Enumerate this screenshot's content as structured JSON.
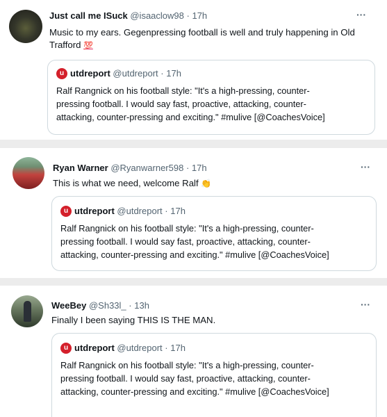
{
  "tweets": [
    {
      "name": "Just call me ISuck",
      "handle": "@isaaclow98",
      "time": "17h",
      "text": "Music to my ears. Gegenpressing football is well and truly happening in Old",
      "text2": "Trafford",
      "emoji": "💯",
      "more": "···",
      "quote": {
        "name": "utdreport",
        "handle": "@utdreport",
        "time": "17h",
        "lines": [
          "Ralf Rangnick on his football style: \"It's a high-pressing, counter-",
          "pressing football. I would say fast, proactive, attacking, counter-",
          "attacking, counter-pressing and exciting.\" #mulive [@CoachesVoice]"
        ]
      }
    },
    {
      "name": "Ryan Warner",
      "handle": "@Ryanwarner598",
      "time": "17h",
      "text": "This is what we need, welcome Ralf",
      "emoji": "👏",
      "more": "···",
      "quote": {
        "name": "utdreport",
        "handle": "@utdreport",
        "time": "17h",
        "lines": [
          "Ralf Rangnick on his football style: \"It's a high-pressing, counter-",
          "pressing football. I would say fast, proactive, attacking, counter-",
          "attacking, counter-pressing and exciting.\" #mulive [@CoachesVoice]"
        ]
      }
    },
    {
      "name": "WeeBey",
      "handle": "@Sh33l_",
      "time": "13h",
      "text": "Finally I been saying THIS IS THE MAN.",
      "more": "···",
      "quote": {
        "name": "utdreport",
        "handle": "@utdreport",
        "time": "17h",
        "lines": [
          "Ralf Rangnick on his football style: \"It's a high-pressing, counter-",
          "pressing football. I would say fast, proactive, attacking, counter-",
          "attacking, counter-pressing and exciting.\" #mulive [@CoachesVoice]"
        ]
      }
    }
  ],
  "separator": "·",
  "quote_logo": "u"
}
